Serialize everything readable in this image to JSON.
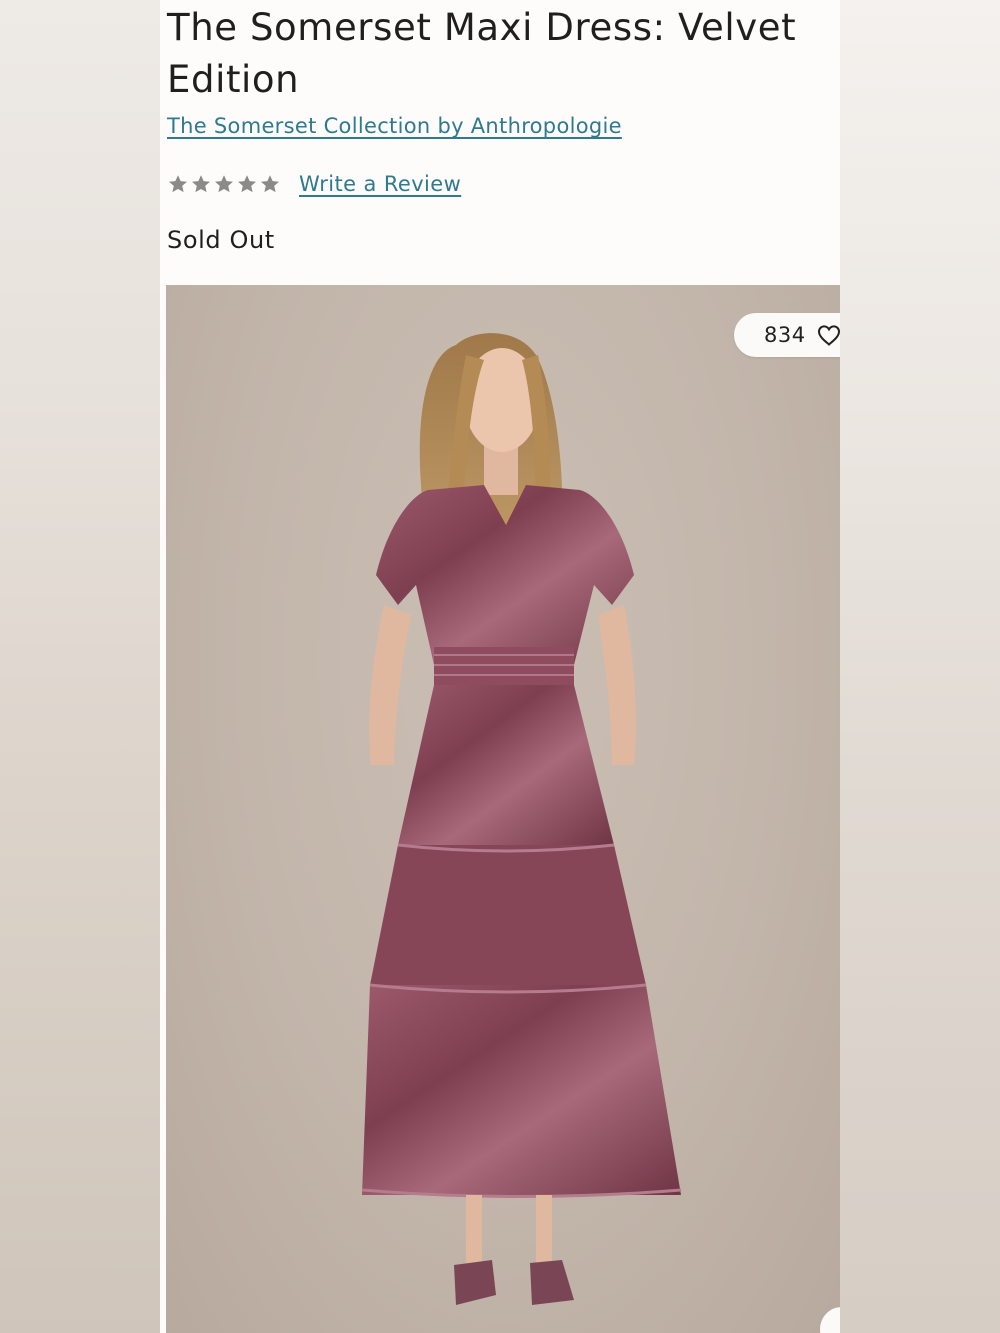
{
  "product": {
    "title": "The Somerset Maxi Dress: Velvet Edition",
    "collection_link": "The Somerset Collection by Anthropologie",
    "rating_stars": 5,
    "rating_filled": 0,
    "review_link": "Write a Review",
    "status": "Sold Out"
  },
  "gallery": {
    "favorites_count": "834",
    "favorite_icon": "heart-outline-icon"
  },
  "colors": {
    "link": "#2f7a8f",
    "text": "#1f1f1f",
    "star_empty": "#8a8a8a",
    "dress": "#8a4a5c"
  }
}
